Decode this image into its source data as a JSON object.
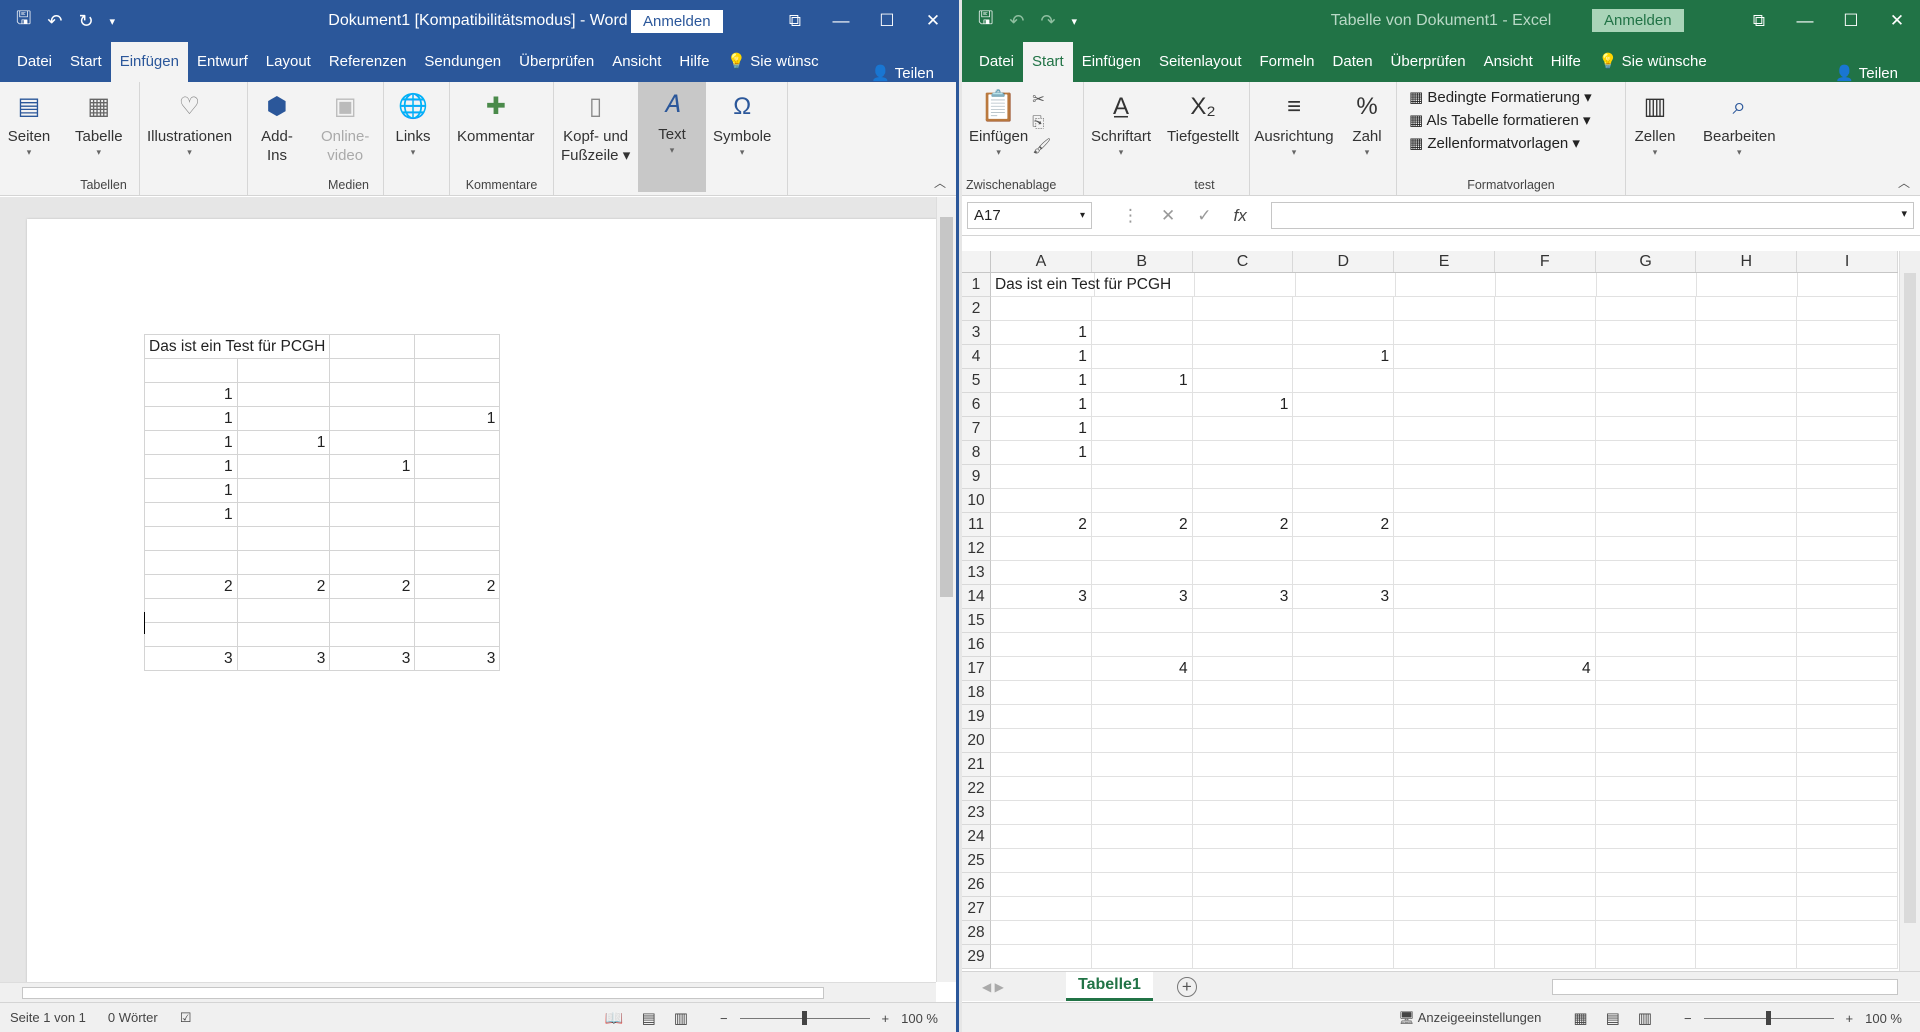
{
  "word": {
    "title": "Dokument1 [Kompatibilitätsmodus]  -  Word",
    "signin": "Anmelden",
    "tabs": [
      "Datei",
      "Start",
      "Einfügen",
      "Entwurf",
      "Layout",
      "Referenzen",
      "Sendungen",
      "Überprüfen",
      "Ansicht",
      "Hilfe"
    ],
    "active_tab": "Einfügen",
    "tell_me": "Sie wünsc",
    "share": "Teilen",
    "ribbon": {
      "seiten": "Seiten",
      "tabelle": "Tabelle",
      "tabellen_group": "Tabellen",
      "illustrationen": "Illustrationen",
      "addins_1": "Add-",
      "addins_2": "Ins",
      "onlinevideo_1": "Online-",
      "onlinevideo_2": "video",
      "medien_group": "Medien",
      "links": "Links",
      "kommentar": "Kommentar",
      "kommentare_group": "Kommentare",
      "kopf_1": "Kopf- und",
      "kopf_2": "Fußzeile",
      "text": "Text",
      "symbole": "Symbole"
    },
    "table": [
      [
        "Das ist ein Test für PCGH",
        "",
        "",
        ""
      ],
      [
        "",
        "",
        "",
        ""
      ],
      [
        "1",
        "",
        "",
        ""
      ],
      [
        "1",
        "",
        "",
        "1"
      ],
      [
        "1",
        "1",
        "",
        ""
      ],
      [
        "1",
        "",
        "1",
        ""
      ],
      [
        "1",
        "",
        "",
        ""
      ],
      [
        "1",
        "",
        "",
        ""
      ],
      [
        "",
        "",
        "",
        ""
      ],
      [
        "",
        "",
        "",
        ""
      ],
      [
        "2",
        "2",
        "2",
        "2"
      ],
      [
        "",
        "",
        "",
        ""
      ],
      [
        "",
        "",
        "",
        ""
      ],
      [
        "3",
        "3",
        "3",
        "3"
      ]
    ],
    "status": {
      "page": "Seite 1 von 1",
      "words": "0 Wörter",
      "zoom": "100 %"
    }
  },
  "excel": {
    "title": "Tabelle von Dokument1  -  Excel",
    "signin": "Anmelden",
    "tabs": [
      "Datei",
      "Start",
      "Einfügen",
      "Seitenlayout",
      "Formeln",
      "Daten",
      "Überprüfen",
      "Ansicht",
      "Hilfe"
    ],
    "active_tab": "Start",
    "tell_me": "Sie wünsche",
    "share": "Teilen",
    "ribbon": {
      "einfuegen": "Einfügen",
      "zwischenablage_group": "Zwischenablage",
      "schriftart": "Schriftart",
      "tiefgestellt": "Tiefgestellt",
      "test_group": "test",
      "ausrichtung": "Ausrichtung",
      "zahl": "Zahl",
      "bedingte": "Bedingte Formatierung",
      "als_tabelle": "Als Tabelle formatieren",
      "zellformat": "Zellenformatvorlagen",
      "formatvorlagen_group": "Formatvorlagen",
      "zellen": "Zellen",
      "bearbeiten": "Bearbeiten"
    },
    "namebox": "A17",
    "columns": [
      "A",
      "B",
      "C",
      "D",
      "E",
      "F",
      "G",
      "H",
      "I"
    ],
    "rows": [
      {
        "n": "1",
        "cells": {
          "A": "Das ist ein Test für PCGH"
        }
      },
      {
        "n": "2",
        "cells": {}
      },
      {
        "n": "3",
        "cells": {
          "A": "1"
        }
      },
      {
        "n": "4",
        "cells": {
          "A": "1",
          "D": "1"
        }
      },
      {
        "n": "5",
        "cells": {
          "A": "1",
          "B": "1"
        }
      },
      {
        "n": "6",
        "cells": {
          "A": "1",
          "C": "1"
        }
      },
      {
        "n": "7",
        "cells": {
          "A": "1"
        }
      },
      {
        "n": "8",
        "cells": {
          "A": "1"
        }
      },
      {
        "n": "9",
        "cells": {}
      },
      {
        "n": "10",
        "cells": {}
      },
      {
        "n": "11",
        "cells": {
          "A": "2",
          "B": "2",
          "C": "2",
          "D": "2"
        }
      },
      {
        "n": "12",
        "cells": {}
      },
      {
        "n": "13",
        "cells": {}
      },
      {
        "n": "14",
        "cells": {
          "A": "3",
          "B": "3",
          "C": "3",
          "D": "3"
        }
      },
      {
        "n": "15",
        "cells": {}
      },
      {
        "n": "16",
        "cells": {}
      },
      {
        "n": "17",
        "cells": {
          "B": "4",
          "F": "4"
        }
      },
      {
        "n": "18",
        "cells": {}
      },
      {
        "n": "19",
        "cells": {}
      },
      {
        "n": "20",
        "cells": {}
      },
      {
        "n": "21",
        "cells": {}
      },
      {
        "n": "22",
        "cells": {}
      },
      {
        "n": "23",
        "cells": {}
      },
      {
        "n": "24",
        "cells": {}
      },
      {
        "n": "25",
        "cells": {}
      },
      {
        "n": "26",
        "cells": {}
      },
      {
        "n": "27",
        "cells": {}
      },
      {
        "n": "28",
        "cells": {}
      },
      {
        "n": "29",
        "cells": {}
      }
    ],
    "sheet_tab": "Tabelle1",
    "status": {
      "display_settings": "Anzeigeeinstellungen",
      "zoom": "100 %"
    }
  },
  "icons": {
    "save": "save-icon",
    "undo": "undo-icon",
    "redo": "redo-icon"
  },
  "colors": {
    "word_blue": "#2b579a",
    "excel_green": "#217346"
  }
}
